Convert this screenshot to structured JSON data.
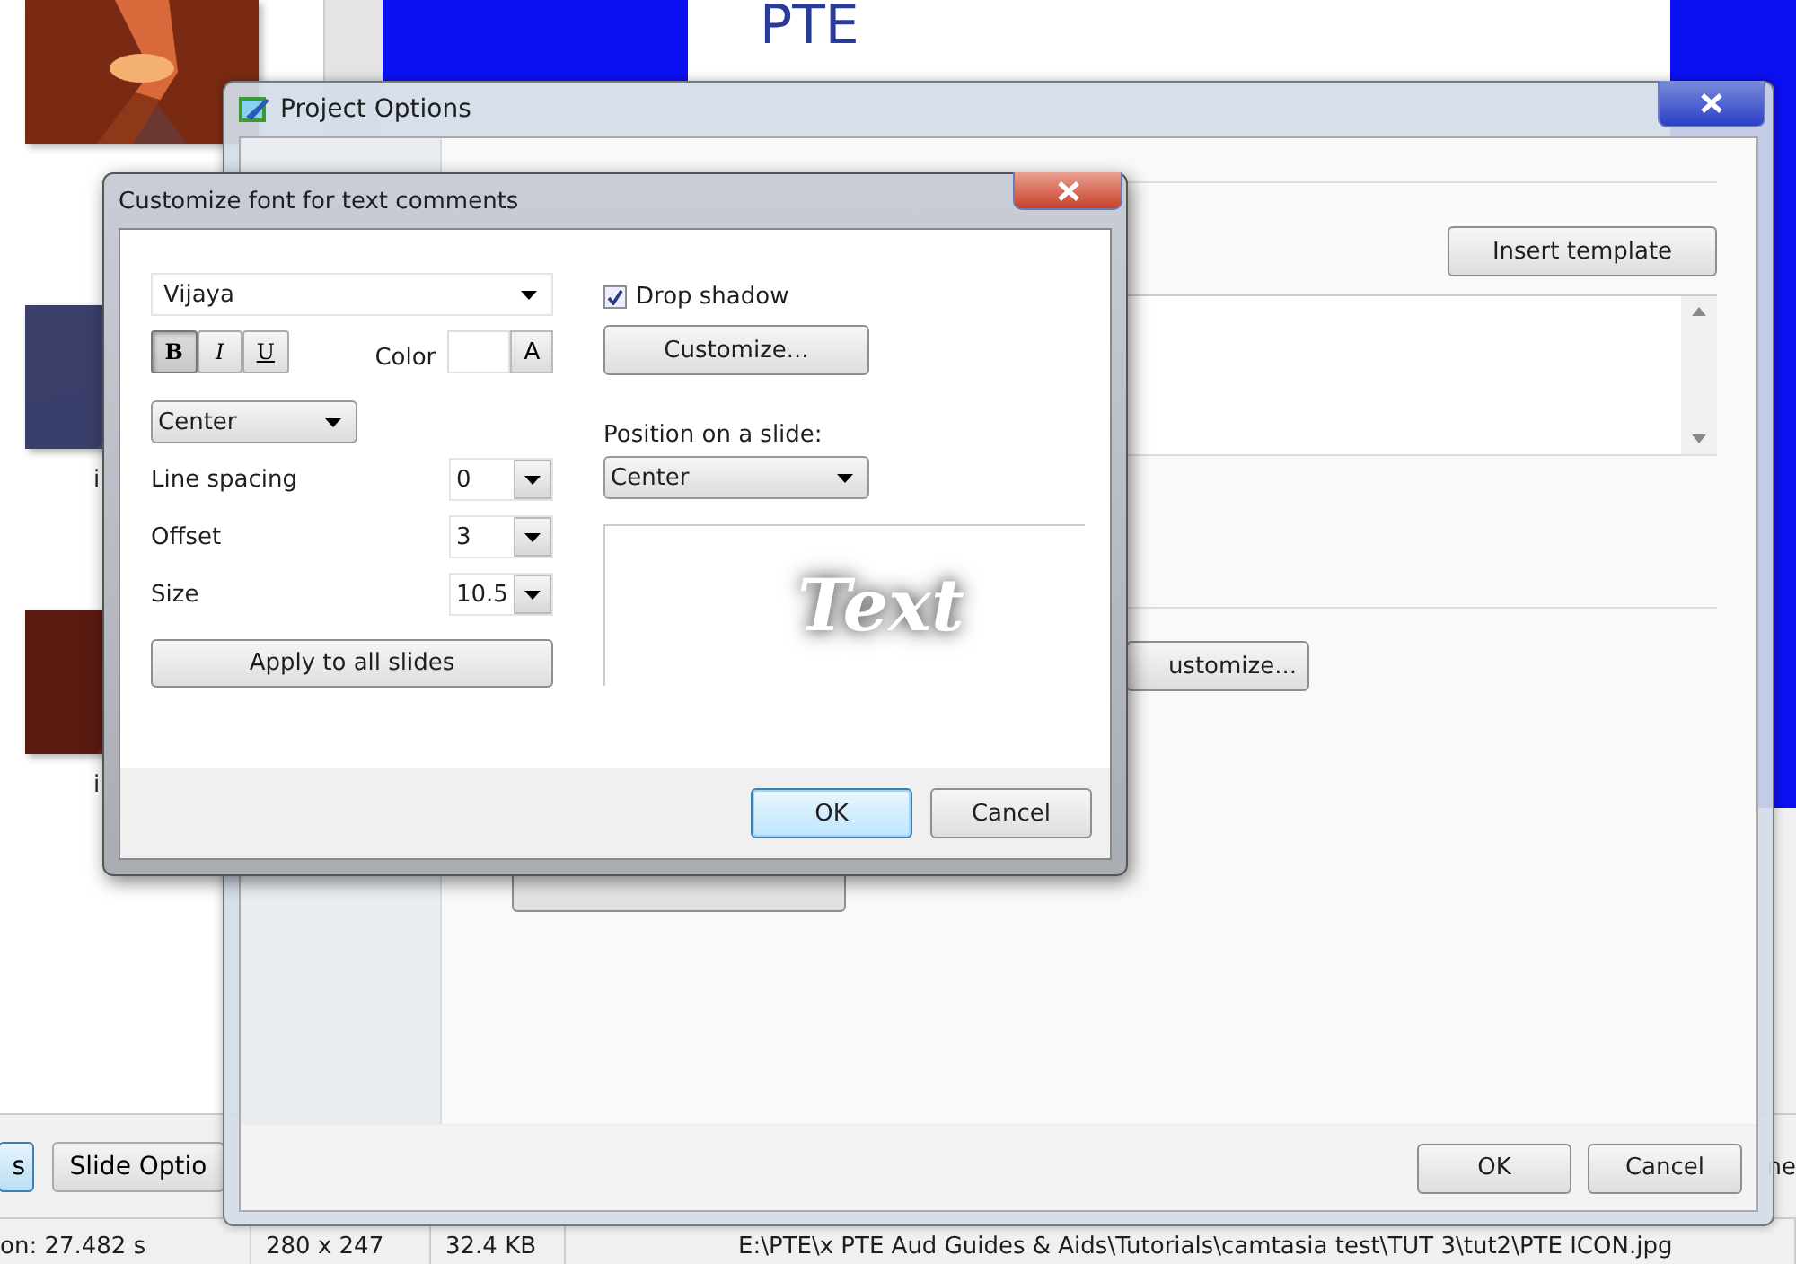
{
  "background_app": {
    "thumbnails": [
      {
        "kind": "picture"
      },
      {
        "kind": "picture",
        "caption": "i"
      },
      {
        "kind": "picture",
        "caption": "i"
      }
    ],
    "preview_text": "PTE",
    "buttons": [
      {
        "label": "s",
        "selected": true
      },
      {
        "label": "Slide Optio",
        "selected": false
      }
    ],
    "side_text": "ne",
    "status_bar": [
      "on: 27.482 s",
      "280 x 247",
      "32.4 KB",
      "E:\\PTE\\x PTE Aud Guides & Aids\\Tutorials\\camtasia test\\TUT 3\\tut2\\PTE ICON.jpg"
    ]
  },
  "project_options": {
    "title": "Project Options",
    "insert_button": "Insert template",
    "customize_button": "ustomize...",
    "buttons": [
      "OK",
      "Cancel"
    ]
  },
  "customize_dialog": {
    "title": "Customize font for text comments",
    "font": "Vijaya",
    "styles": [
      {
        "label": "B",
        "kind": "bold",
        "selected": true
      },
      {
        "label": "I",
        "kind": "italic",
        "selected": false
      },
      {
        "label": "U",
        "kind": "underline",
        "selected": false
      }
    ],
    "color_label": "Color",
    "color_button": "A",
    "color": "#ffffff",
    "alignment": "Center",
    "spinners": [
      {
        "label": "Line spacing",
        "value": "0"
      },
      {
        "label": "Offset",
        "value": "3"
      },
      {
        "label": "Size",
        "value": "10.5"
      }
    ],
    "apply_button": "Apply to all slides",
    "drop_shadow": {
      "label": "Drop shadow",
      "checked": true
    },
    "customize_button": "Customize...",
    "position_label": "Position on a slide:",
    "position": "Center",
    "preview_text": "Text",
    "buttons": [
      {
        "label": "OK",
        "default": true
      },
      {
        "label": "Cancel",
        "default": false
      }
    ]
  }
}
